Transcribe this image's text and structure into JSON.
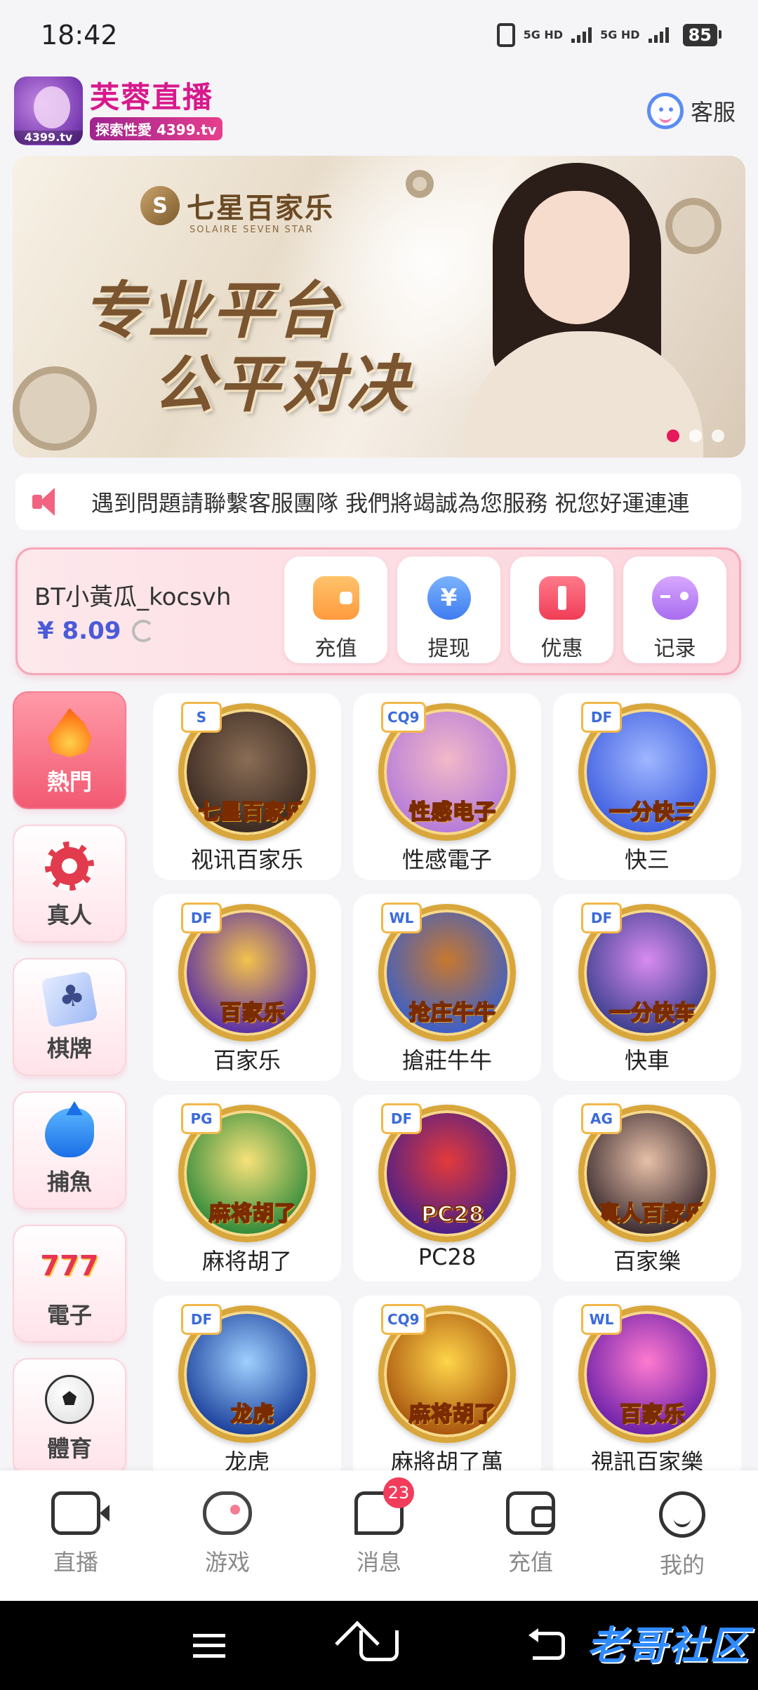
{
  "status_bar": {
    "time": "18:42",
    "network_1": "5G HD",
    "network_2": "5G HD",
    "battery": "85"
  },
  "header": {
    "logo_text": "4399.tv",
    "brand_name": "芙蓉直播",
    "brand_tag": "探索性愛 4399.tv",
    "service_label": "客服"
  },
  "banner": {
    "logo_text": "七星百家乐",
    "logo_sub": "SOLAIRE SEVEN STAR",
    "line1": "专业平台",
    "line2": "公平对决",
    "slide_count": 3,
    "active_slide": 0
  },
  "notice": {
    "text": "遇到問題請聯繫客服團隊 我們將竭誠為您服務 祝您好運連連"
  },
  "account": {
    "username": "BT小黃瓜_kocsvh",
    "balance": "¥ 8.09",
    "actions": [
      {
        "label": "充值",
        "icon": "wallet-icon"
      },
      {
        "label": "提现",
        "icon": "yen-icon"
      },
      {
        "label": "优惠",
        "icon": "ticket-icon"
      },
      {
        "label": "记录",
        "icon": "gamepad-icon"
      }
    ]
  },
  "sidebar": {
    "items": [
      {
        "label": "熱門",
        "icon": "fire-icon",
        "active": true
      },
      {
        "label": "真人",
        "icon": "chip-icon",
        "active": false
      },
      {
        "label": "棋牌",
        "icon": "cards-icon",
        "active": false
      },
      {
        "label": "捕魚",
        "icon": "shark-icon",
        "active": false
      },
      {
        "label": "電子",
        "icon": "slot-777-icon",
        "active": false
      },
      {
        "label": "體育",
        "icon": "soccer-ball-icon",
        "active": false
      }
    ]
  },
  "games": [
    {
      "label": "视讯百家乐",
      "art_title": "七星百家乐",
      "badge": "S",
      "colors": [
        "#3a2a22",
        "#8a6d55"
      ]
    },
    {
      "label": "性感電子",
      "art_title": "性感电子",
      "badge": "CQ9",
      "colors": [
        "#b57bd9",
        "#f2b8c8"
      ]
    },
    {
      "label": "快三",
      "art_title": "一分快三",
      "badge": "DF",
      "colors": [
        "#3f5fe0",
        "#9fb6ff"
      ]
    },
    {
      "label": "百家乐",
      "art_title": "百家乐",
      "badge": "DF",
      "colors": [
        "#5a2ea8",
        "#f2c24b"
      ]
    },
    {
      "label": "搶莊牛牛",
      "art_title": "抢庄牛牛",
      "badge": "WL",
      "colors": [
        "#3b5fc9",
        "#c7782f"
      ]
    },
    {
      "label": "快車",
      "art_title": "一分快车",
      "badge": "DF",
      "colors": [
        "#3b3f8f",
        "#d88bf0"
      ]
    },
    {
      "label": "麻将胡了",
      "art_title": "麻将胡了",
      "badge": "PG",
      "colors": [
        "#2f8a3a",
        "#f7e27a"
      ]
    },
    {
      "label": "PC28",
      "art_title": "PC28",
      "badge": "DF",
      "colors": [
        "#4a1f8a",
        "#e33a3a"
      ]
    },
    {
      "label": "百家樂",
      "art_title": "真人百家乐",
      "badge": "AG",
      "colors": [
        "#3a2a30",
        "#e7c0a8"
      ]
    },
    {
      "label": "龙虎",
      "art_title": "龙虎",
      "badge": "DF",
      "colors": [
        "#1a3f9a",
        "#9fd0ff"
      ]
    },
    {
      "label": "麻將胡了萬",
      "art_title": "麻将胡了",
      "badge": "CQ9",
      "colors": [
        "#a8550e",
        "#ffd54a"
      ]
    },
    {
      "label": "視訊百家樂",
      "art_title": "百家乐",
      "badge": "WL",
      "colors": [
        "#6a1fa8",
        "#ff7ad0"
      ]
    }
  ],
  "bottom_nav": {
    "items": [
      {
        "label": "直播",
        "icon": "live-camera-icon"
      },
      {
        "label": "游戏",
        "icon": "gamepad-icon"
      },
      {
        "label": "消息",
        "icon": "message-icon",
        "badge": "23"
      },
      {
        "label": "充值",
        "icon": "wallet-icon"
      },
      {
        "label": "我的",
        "icon": "smiley-icon"
      }
    ]
  },
  "watermark": "老哥社区"
}
